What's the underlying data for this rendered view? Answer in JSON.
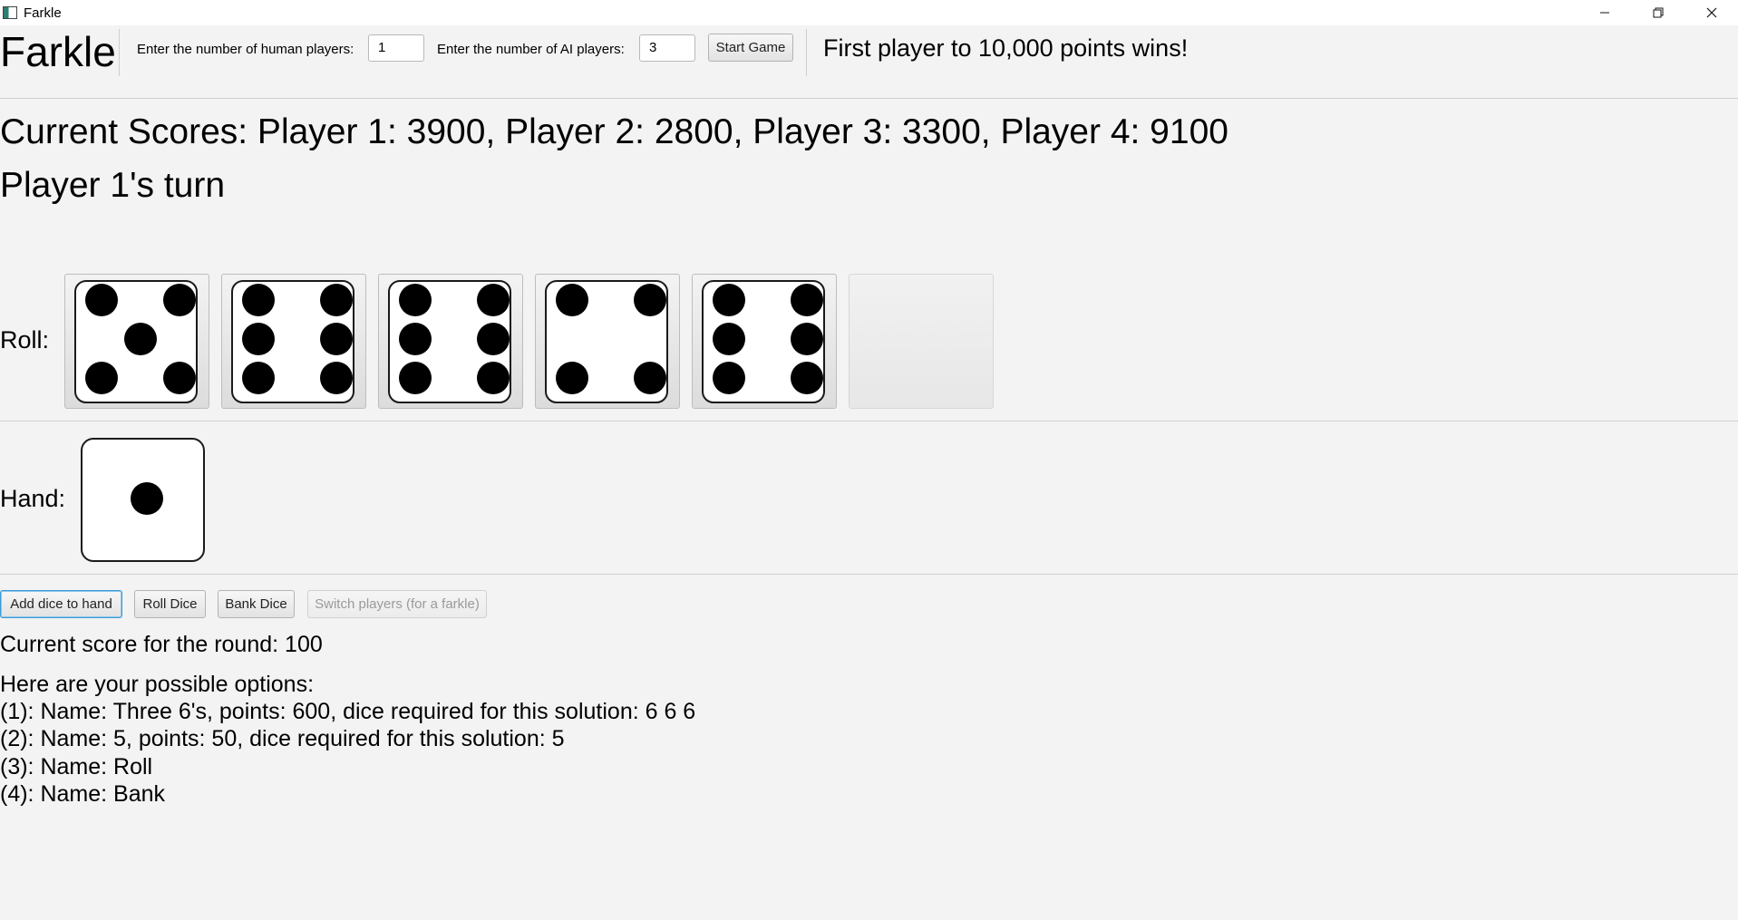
{
  "window": {
    "title": "Farkle",
    "controls": [
      "minimize-icon",
      "restore-icon",
      "close-icon"
    ]
  },
  "toolbar": {
    "app_title": "Farkle",
    "human_label": "Enter the number of human players:",
    "human_value": "1",
    "ai_label": "Enter the number of AI players:",
    "ai_value": "3",
    "start_label": "Start Game",
    "win_message": "First player to 10,000 points wins!"
  },
  "status": {
    "scores": "Current Scores: Player 1: 3900, Player 2: 2800, Player 3: 3300, Player 4: 9100",
    "turn": "Player 1's turn"
  },
  "roll": {
    "label": "Roll:",
    "dice": [
      5,
      6,
      6,
      4,
      6,
      null
    ]
  },
  "hand": {
    "label": "Hand:",
    "dice": [
      1
    ]
  },
  "actions": {
    "add_label": "Add dice to hand",
    "roll_label": "Roll Dice",
    "bank_label": "Bank Dice",
    "switch_label": "Switch players (for a farkle)"
  },
  "round_score": "Current score for the round: 100",
  "options": {
    "header": "Here are your possible options:",
    "items": [
      "(1): Name: Three 6's, points: 600, dice required for this solution: 6 6 6",
      "(2): Name: 5, points: 50, dice required for this solution: 5",
      "(3): Name: Roll",
      "(4): Name: Bank"
    ]
  }
}
